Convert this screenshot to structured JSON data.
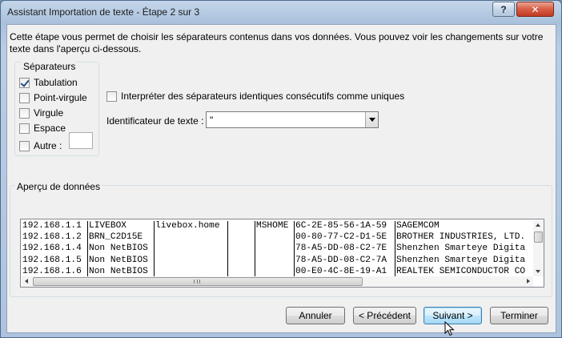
{
  "window": {
    "title": "Assistant Importation de texte - Étape 2 sur 3"
  },
  "titlebar": {
    "help_label": "?",
    "close_label": "✕"
  },
  "intro_text": "Cette étape vous permet de choisir les séparateurs contenus dans vos données. Vous pouvez voir les changements sur votre texte dans l'aperçu ci-dessous.",
  "separators": {
    "legend": "Séparateurs",
    "options": [
      {
        "label": "Tabulation",
        "checked": true
      },
      {
        "label": "Point-virgule",
        "checked": false
      },
      {
        "label": "Virgule",
        "checked": false
      },
      {
        "label": "Espace",
        "checked": false
      },
      {
        "label": "Autre :",
        "checked": false,
        "value": ""
      }
    ]
  },
  "consecutive": {
    "label": "Interpréter des séparateurs identiques consécutifs comme uniques",
    "checked": false
  },
  "text_qualifier": {
    "label": "Identificateur de texte :",
    "value": "\""
  },
  "preview": {
    "legend": "Aperçu de données",
    "rows": [
      [
        "192.168.1.1",
        "LIVEBOX",
        "livebox.home",
        "",
        "MSHOME",
        "6C-2E-85-56-1A-59",
        "SAGEMCOM"
      ],
      [
        "192.168.1.2",
        "BRN_C2D15E",
        "",
        "",
        "",
        "00-80-77-C2-D1-5E",
        "BROTHER INDUSTRIES, LTD."
      ],
      [
        "192.168.1.4",
        "Non NetBIOS",
        "",
        "",
        "",
        "78-A5-DD-08-C2-7E",
        "Shenzhen Smarteye Digita"
      ],
      [
        "192.168.1.5",
        "Non NetBIOS",
        "",
        "",
        "",
        "78-A5-DD-08-C2-7A",
        "Shenzhen Smarteye Digita"
      ],
      [
        "192.168.1.6",
        "Non NetBIOS",
        "",
        "",
        "",
        "00-E0-4C-8E-19-A1",
        "REALTEK SEMICONDUCTOR CO"
      ]
    ]
  },
  "buttons": {
    "cancel": "Annuler",
    "previous": "< Précédent",
    "next": "Suivant >",
    "finish": "Terminer"
  },
  "colors": {
    "accent": "#3c7fb1",
    "close_button": "#c03a22"
  }
}
